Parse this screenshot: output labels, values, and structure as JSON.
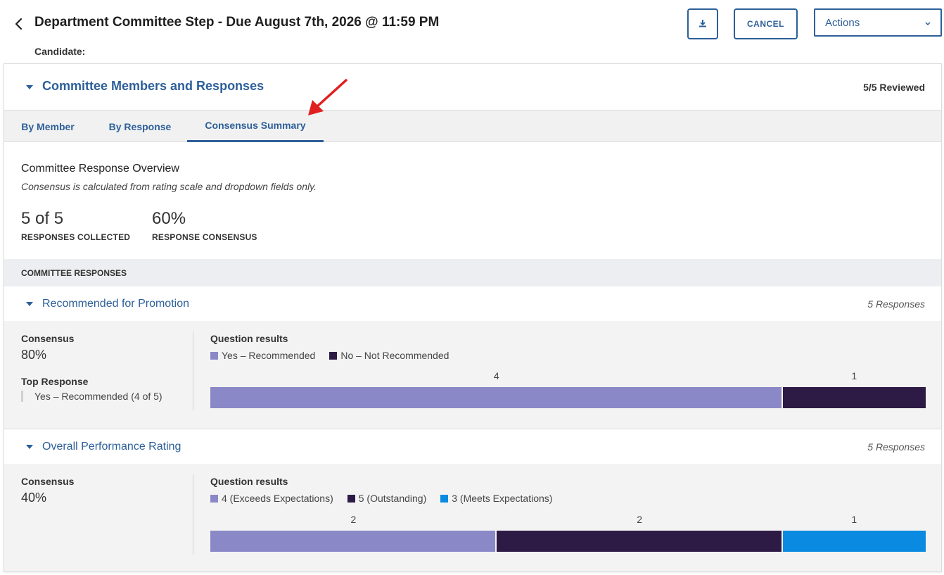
{
  "header": {
    "title": "Department Committee Step - Due August 7th, 2026 @ 11:59 PM",
    "candidate_label": "Candidate:",
    "cancel_label": "CANCEL",
    "actions_label": "Actions",
    "back_icon": "chevron-left-icon",
    "download_icon": "download-icon"
  },
  "panel": {
    "title": "Committee Members and Responses",
    "reviewed": "5/5 Reviewed",
    "tabs": [
      {
        "label": "By Member",
        "active": false
      },
      {
        "label": "By Response",
        "active": false
      },
      {
        "label": "Consensus Summary",
        "active": true
      }
    ]
  },
  "overview": {
    "title": "Committee Response Overview",
    "note": "Consensus is calculated from rating scale and dropdown fields only.",
    "stats": [
      {
        "value": "5 of 5",
        "label": "RESPONSES COLLECTED"
      },
      {
        "value": "60%",
        "label": "RESPONSE CONSENSUS"
      }
    ]
  },
  "committee_responses_label": "COMMITTEE RESPONSES",
  "questions": [
    {
      "title": "Recommended for Promotion",
      "responses": "5 Responses",
      "consensus_label": "Consensus",
      "consensus_value": "80%",
      "top_response_label": "Top Response",
      "top_response_value": "Yes – Recommended (4 of 5)",
      "results_label": "Question results",
      "options": [
        {
          "label": "Yes – Recommended",
          "count": 4,
          "color": "#8b88c8"
        },
        {
          "label": "No – Not Recommended",
          "count": 1,
          "color": "#2d1b45"
        }
      ]
    },
    {
      "title": "Overall Performance Rating",
      "responses": "5 Responses",
      "consensus_label": "Consensus",
      "consensus_value": "40%",
      "results_label": "Question results",
      "options": [
        {
          "label": "4 (Exceeds Expectations)",
          "count": 2,
          "color": "#8b88c8"
        },
        {
          "label": "5 (Outstanding)",
          "count": 2,
          "color": "#2d1b45"
        },
        {
          "label": "3 (Meets Expectations)",
          "count": 1,
          "color": "#0a8ae0"
        }
      ]
    }
  ],
  "colors": {
    "accent": "#2d5f99",
    "annotation_arrow": "#e02020"
  }
}
